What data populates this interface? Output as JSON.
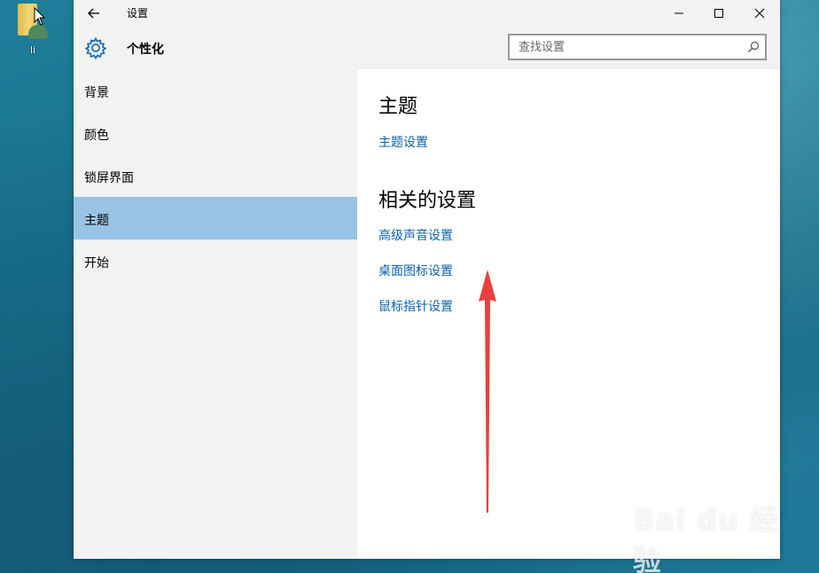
{
  "desktop": {
    "icon_label": "li"
  },
  "window": {
    "title": "设置",
    "minimize_glyph": "—",
    "maximize_glyph": "☐",
    "close_glyph": "✕"
  },
  "header": {
    "page_title": "个性化",
    "search_placeholder": "查找设置"
  },
  "sidebar": {
    "items": [
      {
        "label": "背景",
        "selected": false
      },
      {
        "label": "颜色",
        "selected": false
      },
      {
        "label": "锁屏界面",
        "selected": false
      },
      {
        "label": "主题",
        "selected": true
      },
      {
        "label": "开始",
        "selected": false
      }
    ]
  },
  "content": {
    "section1_title": "主题",
    "theme_settings_link": "主题设置",
    "section2_title": "相关的设置",
    "related_links": [
      "高级声音设置",
      "桌面图标设置",
      "鼠标指针设置"
    ]
  },
  "watermark": {
    "text": "Bai du 经验",
    "url": "jingyan.baidu.com"
  },
  "icons": {
    "back": "arrow-left-icon",
    "settings": "gear-icon",
    "search": "search-icon",
    "annotation": "red-arrow-icon"
  },
  "colors": {
    "accent": "#0b62a8",
    "selected_bg": "#99c3e4",
    "sidebar_bg": "#f2f2f2",
    "arrow": "#e8403a"
  }
}
